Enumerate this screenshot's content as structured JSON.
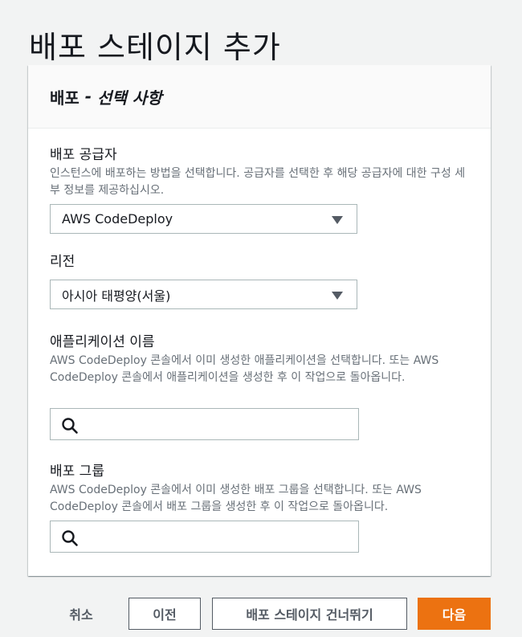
{
  "page": {
    "title": "배포 스테이지 추가"
  },
  "panel": {
    "title": "배포",
    "title_sep": " - ",
    "title_optional": "선택 사항"
  },
  "fields": {
    "provider": {
      "label": "배포 공급자",
      "description": "인스턴스에 배포하는 방법을 선택합니다. 공급자를 선택한 후 해당 공급자에 대한 구성 세부 정보를 제공하십시오.",
      "value": "AWS CodeDeploy"
    },
    "region": {
      "label": "리전",
      "value": "아시아 태평양(서울)"
    },
    "application": {
      "label": "애플리케이션 이름",
      "description": "AWS CodeDeploy 콘솔에서 이미 생성한 애플리케이션을 선택합니다. 또는 AWS CodeDeploy 콘솔에서 애플리케이션을 생성한 후 이 작업으로 돌아옵니다.",
      "value": ""
    },
    "deployment_group": {
      "label": "배포 그룹",
      "description": "AWS CodeDeploy 콘솔에서 이미 생성한 배포 그룹을 선택합니다. 또는 AWS CodeDeploy 콘솔에서 배포 그룹을 생성한 후 이 작업으로 돌아옵니다.",
      "value": ""
    }
  },
  "footer": {
    "cancel": "취소",
    "previous": "이전",
    "skip": "배포 스테이지 건너뛰기",
    "next": "다음"
  },
  "colors": {
    "primary": "#ec7211",
    "border": "#aab7b8",
    "muted": "#687078"
  },
  "icons": {
    "select_caret": "caret-down-icon",
    "search": "search-icon"
  }
}
